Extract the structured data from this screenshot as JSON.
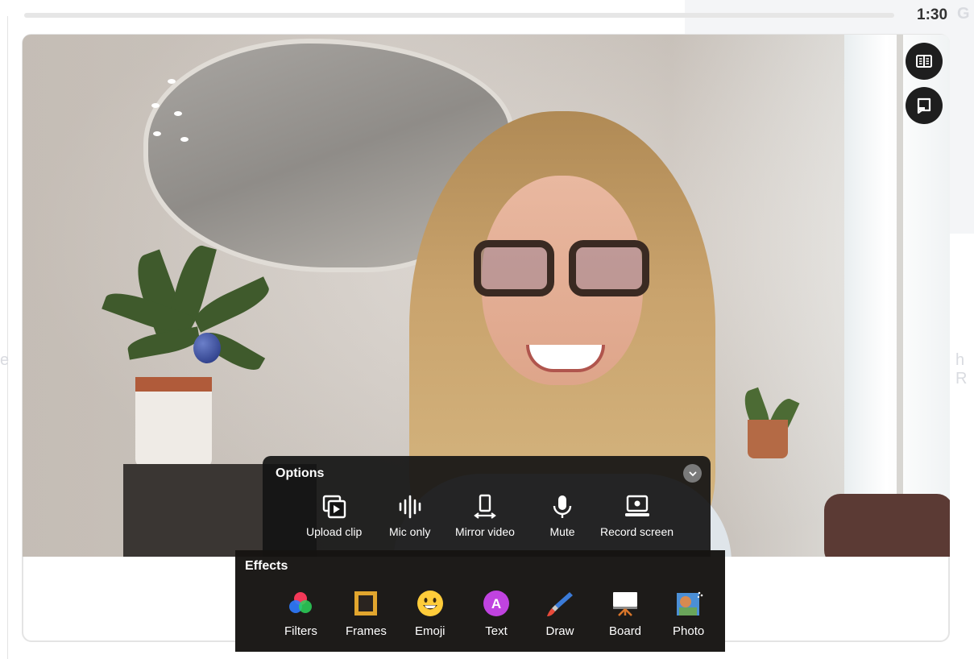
{
  "recorder": {
    "timer": "1:30",
    "progress": 0.0
  },
  "options": {
    "title": "Options",
    "items": [
      {
        "label": "Upload clip",
        "icon": "upload-clip-icon"
      },
      {
        "label": "Mic only",
        "icon": "mic-only-icon"
      },
      {
        "label": "Mirror video",
        "icon": "mirror-video-icon"
      },
      {
        "label": "Mute",
        "icon": "microphone-icon"
      },
      {
        "label": "Record screen",
        "icon": "record-screen-icon"
      }
    ]
  },
  "effects": {
    "title": "Effects",
    "items": [
      {
        "label": "Filters",
        "icon": "filters-icon"
      },
      {
        "label": "Frames",
        "icon": "frames-icon"
      },
      {
        "label": "Emoji",
        "icon": "emoji-icon"
      },
      {
        "label": "Text",
        "icon": "text-icon"
      },
      {
        "label": "Draw",
        "icon": "draw-icon"
      },
      {
        "label": "Board",
        "icon": "board-icon"
      },
      {
        "label": "Photo",
        "icon": "photo-icon"
      }
    ],
    "text_icon_letter": "A"
  },
  "side_buttons": [
    {
      "icon": "notes-icon"
    },
    {
      "icon": "teleprompter-icon"
    }
  ],
  "colors": {
    "panel_bg": "#141414",
    "text_badge": "#c043e0",
    "frames_gold": "#e2a62e",
    "emoji_yellow": "#ffcc3a"
  }
}
